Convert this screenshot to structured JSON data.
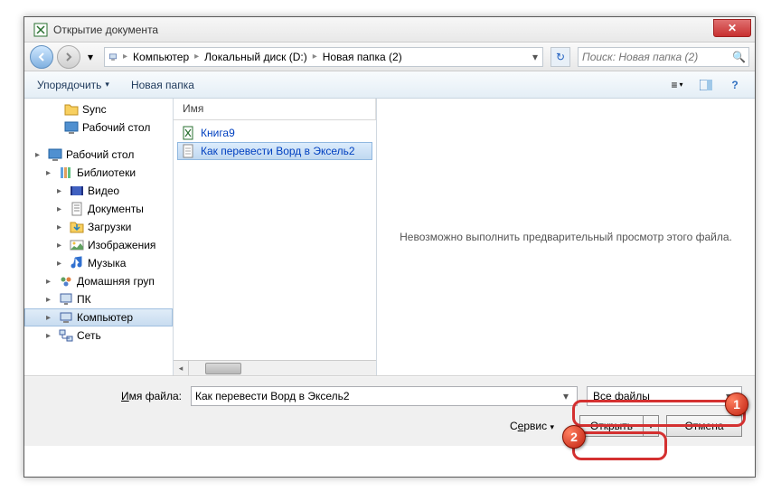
{
  "window": {
    "title": "Открытие документа",
    "close_glyph": "✕"
  },
  "nav": {
    "back_arrow": "←",
    "fwd_arrow": "→",
    "drop_glyph": "▾"
  },
  "breadcrumb": {
    "items": [
      "Компьютер",
      "Локальный диск (D:)",
      "Новая папка (2)"
    ],
    "sep": "▸",
    "refresh_glyph": "↻"
  },
  "search": {
    "placeholder": "Поиск: Новая папка (2)",
    "icon": "🔍"
  },
  "toolbar": {
    "organize": "Упорядочить",
    "new_folder": "Новая папка",
    "drop": "▾",
    "view_glyph": "≡",
    "preview_glyph": "▭",
    "help_glyph": "?"
  },
  "sidebar": {
    "items": [
      {
        "indent": 22,
        "exp": "",
        "icon": "folder",
        "label": "Sync"
      },
      {
        "indent": 22,
        "exp": "",
        "icon": "desktop",
        "label": "Рабочий стол"
      },
      {
        "indent": 0,
        "exp": "",
        "icon": "",
        "label": ""
      },
      {
        "indent": 4,
        "exp": "▸",
        "icon": "desktop",
        "label": "Рабочий стол"
      },
      {
        "indent": 16,
        "exp": "▸",
        "icon": "lib",
        "label": "Библиотеки"
      },
      {
        "indent": 28,
        "exp": "▸",
        "icon": "video",
        "label": "Видео"
      },
      {
        "indent": 28,
        "exp": "▸",
        "icon": "doc",
        "label": "Документы"
      },
      {
        "indent": 28,
        "exp": "▸",
        "icon": "download",
        "label": "Загрузки"
      },
      {
        "indent": 28,
        "exp": "▸",
        "icon": "image",
        "label": "Изображения"
      },
      {
        "indent": 28,
        "exp": "▸",
        "icon": "music",
        "label": "Музыка"
      },
      {
        "indent": 16,
        "exp": "▸",
        "icon": "homegroup",
        "label": "Домашняя груп"
      },
      {
        "indent": 16,
        "exp": "▸",
        "icon": "pc",
        "label": "ПК"
      },
      {
        "indent": 16,
        "exp": "▸",
        "icon": "computer",
        "label": "Компьютер",
        "selected": true
      },
      {
        "indent": 16,
        "exp": "▸",
        "icon": "network",
        "label": "Сеть"
      }
    ]
  },
  "filelist": {
    "header": "Имя",
    "files": [
      {
        "icon": "txt",
        "name": "Как перевести Ворд в Эксель2",
        "selected": true
      },
      {
        "icon": "xls",
        "name": "Книга9",
        "selected": false
      }
    ]
  },
  "preview": {
    "message": "Невозможно выполнить предварительный просмотр этого файла."
  },
  "bottom": {
    "filename_label_pre": "Имя файла:",
    "filename_underline": "И",
    "filename_rest": "мя файла:",
    "filename_value": "Как перевести Ворд в Эксель2",
    "filter_value": "Все файлы",
    "service_label_pre": "С",
    "service_underline": "е",
    "service_rest": "рвис",
    "open_label": "Открыть",
    "cancel_label": "Отмена",
    "drop": "▾",
    "combo_drop": "▾"
  },
  "badges": {
    "one": "1",
    "two": "2"
  }
}
